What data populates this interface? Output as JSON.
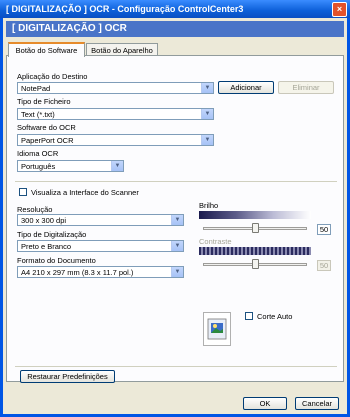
{
  "window": {
    "title": "[ DIGITALIZAÇÃO ]   OCR - Configuração ControlCenter3",
    "close_glyph": "×"
  },
  "header": {
    "title": "[ DIGITALIZAÇÃO ]   OCR"
  },
  "tabs": [
    {
      "label": "Botão do Software",
      "active": true
    },
    {
      "label": "Botão do Aparelho",
      "active": false
    }
  ],
  "destination": {
    "label": "Aplicação do Destino",
    "value": "NotePad",
    "add_label": "Adicionar",
    "remove_label": "Eliminar"
  },
  "file_type": {
    "label": "Tipo de Ficheiro",
    "value": "Text (*.txt)"
  },
  "ocr_software": {
    "label": "Software do OCR",
    "value": "PaperPort OCR"
  },
  "ocr_language": {
    "label": "Idioma OCR",
    "value": "Português"
  },
  "scanner_interface": {
    "label": "Visualiza a Interface do Scanner",
    "checked": false
  },
  "resolution": {
    "label": "Resolução",
    "value": "300 x 300 dpi"
  },
  "scan_type": {
    "label": "Tipo de Digitalização",
    "value": "Preto e Branco"
  },
  "document_size": {
    "label": "Formato do Documento",
    "value": "A4 210 x 297 mm (8.3 x 11.7 pol.)"
  },
  "brightness": {
    "label": "Brilho",
    "value": "50",
    "level_percent": 50
  },
  "contrast": {
    "label": "Contraste",
    "value": "50",
    "level_percent": 50,
    "enabled": false
  },
  "auto_crop": {
    "label": "Corte Auto",
    "checked": false
  },
  "restore_label": "Restaurar Predefinições",
  "ok_label": "OK",
  "cancel_label": "Cancelar",
  "dropdown_glyph": "▼"
}
